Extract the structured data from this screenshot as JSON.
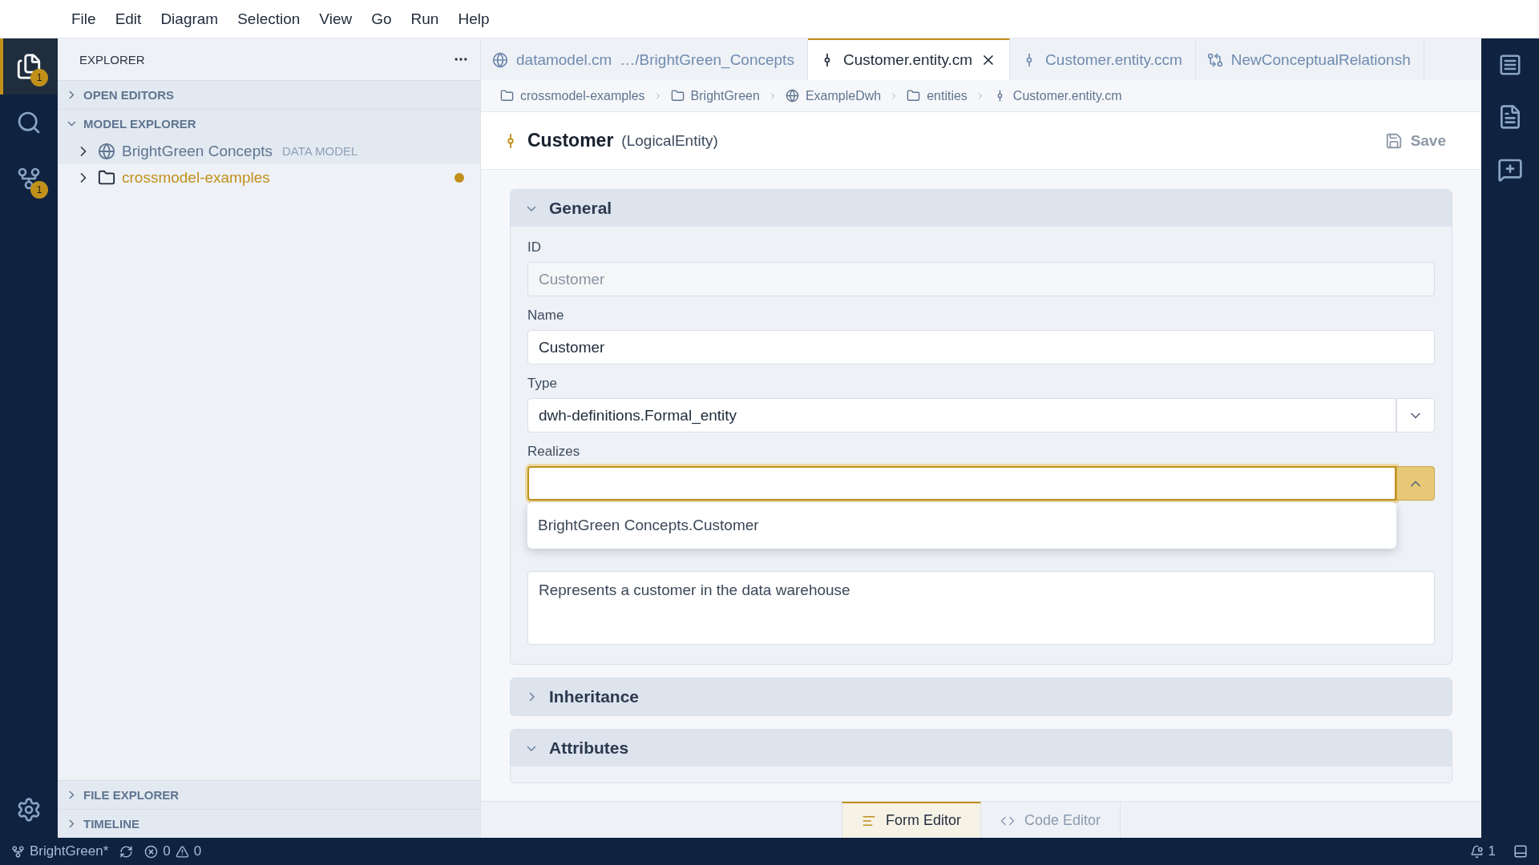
{
  "menu": [
    "File",
    "Edit",
    "Diagram",
    "Selection",
    "View",
    "Go",
    "Run",
    "Help"
  ],
  "activity_bar": {
    "items": [
      {
        "kind": "explorer",
        "selected": true,
        "badge": "1"
      },
      {
        "kind": "search",
        "selected": false
      },
      {
        "kind": "source-control",
        "selected": false,
        "badge": "1"
      }
    ]
  },
  "sidebar": {
    "title": "EXPLORER",
    "sections": [
      {
        "label": "OPEN EDITORS",
        "expanded": false
      },
      {
        "label": "MODEL EXPLORER",
        "expanded": true,
        "items": [
          {
            "label": "BrightGreen Concepts",
            "kind": "data-model",
            "detail": "DATA MODEL",
            "selected": true,
            "modified": false
          },
          {
            "label": "crossmodel-examples",
            "kind": "folder",
            "selected": false,
            "modified": true
          }
        ]
      }
    ],
    "bottom_sections": [
      {
        "label": "FILE EXPLORER",
        "expanded": false
      },
      {
        "label": "TIMELINE",
        "expanded": false
      }
    ]
  },
  "tabs": [
    {
      "label": "datamodel.cm",
      "detail": "…/BrightGreen_Concepts",
      "kind": "data-model",
      "selected": false
    },
    {
      "label": "Customer.entity.cm",
      "kind": "entity",
      "selected": true
    },
    {
      "label": "Customer.entity.ccm",
      "kind": "entity",
      "selected": false
    },
    {
      "label": "NewConceptualRelationsh",
      "kind": "relationship",
      "selected": false
    }
  ],
  "breadcrumbs": [
    {
      "label": "crossmodel-examples",
      "kind": "folder"
    },
    {
      "label": "BrightGreen",
      "kind": "folder"
    },
    {
      "label": "ExampleDwh",
      "kind": "data-model"
    },
    {
      "label": "entities",
      "kind": "folder"
    },
    {
      "label": "Customer.entity.cm",
      "kind": "entity"
    }
  ],
  "editor": {
    "title": "Customer",
    "type": "(LogicalEntity)",
    "save": "Save",
    "sections": [
      {
        "title": "General",
        "expanded": true,
        "fields": [
          {
            "kind": "text",
            "label": "ID",
            "value": "Customer",
            "disabled": true
          },
          {
            "kind": "text",
            "label": "Name",
            "value": "Customer",
            "disabled": false
          },
          {
            "kind": "select",
            "label": "Type",
            "value": "dwh-definitions.Formal_entity",
            "expanded": false
          },
          {
            "kind": "combo",
            "label": "Realizes",
            "expanded": true,
            "options": [
              "BrightGreen Concepts.Customer"
            ]
          },
          {
            "kind": "textarea",
            "value": "Represents a customer in the data warehouse"
          }
        ]
      },
      {
        "title": "Inheritance",
        "expanded": false
      },
      {
        "title": "Attributes",
        "expanded": true
      }
    ]
  },
  "editor_tabs": [
    {
      "label": "Form Editor",
      "kind": "form",
      "selected": true
    },
    {
      "label": "Code Editor",
      "kind": "code",
      "selected": false
    }
  ],
  "status_bar": {
    "branch": "BrightGreen*",
    "errors": "0",
    "warnings": "0",
    "notifications": "1"
  }
}
